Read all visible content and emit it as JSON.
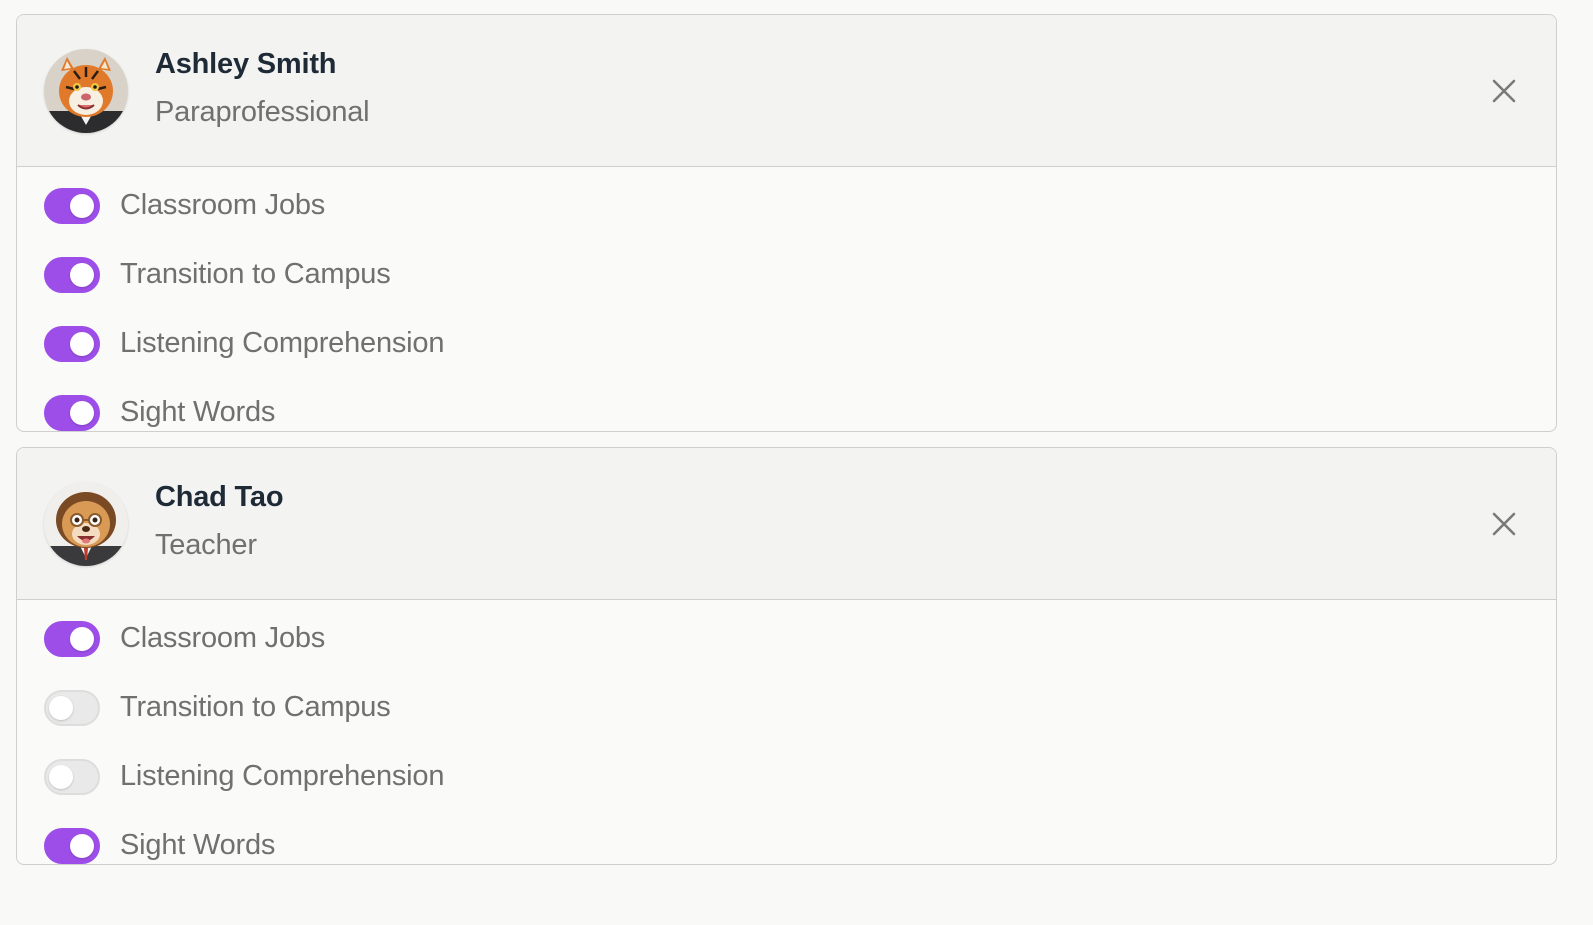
{
  "staff": [
    {
      "name": "Ashley Smith",
      "role": "Paraprofessional",
      "avatar_icon": "tiger-avatar-icon",
      "permissions": [
        {
          "label": "Classroom Jobs",
          "enabled": true
        },
        {
          "label": "Transition to Campus",
          "enabled": true
        },
        {
          "label": "Listening Comprehension",
          "enabled": true
        },
        {
          "label": "Sight Words",
          "enabled": true
        }
      ]
    },
    {
      "name": "Chad Tao",
      "role": "Teacher",
      "avatar_icon": "lion-avatar-icon",
      "permissions": [
        {
          "label": "Classroom Jobs",
          "enabled": true
        },
        {
          "label": "Transition to Campus",
          "enabled": false
        },
        {
          "label": "Listening Comprehension",
          "enabled": false
        },
        {
          "label": "Sight Words",
          "enabled": true
        }
      ]
    }
  ],
  "colors": {
    "toggle_on": "#9d4ee8",
    "toggle_off": "#e9e9e9",
    "name_text": "#1f2a37",
    "muted_text": "#707070"
  },
  "icons": {
    "close": "close-icon"
  }
}
